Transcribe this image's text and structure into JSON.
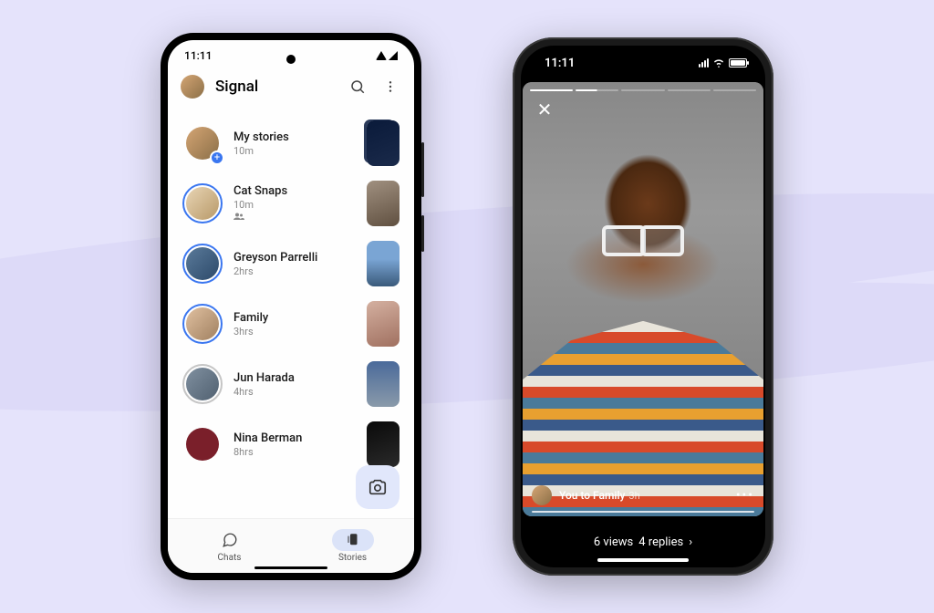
{
  "android": {
    "statusbar": {
      "time": "11:11"
    },
    "header": {
      "title": "Signal"
    },
    "stories": [
      {
        "name": "My stories",
        "time": "10m",
        "mine": true
      },
      {
        "name": "Cat Snaps",
        "time": "10m",
        "group": true
      },
      {
        "name": "Greyson Parrelli",
        "time": "2hrs"
      },
      {
        "name": "Family",
        "time": "3hrs"
      },
      {
        "name": "Jun Harada",
        "time": "4hrs"
      },
      {
        "name": "Nina Berman",
        "time": "8hrs"
      }
    ],
    "nav": {
      "chats": "Chats",
      "stories": "Stories"
    }
  },
  "iphone": {
    "statusbar": {
      "time": "11:11"
    },
    "story": {
      "author": "You to Family",
      "time": "3h",
      "views_label": "6 views",
      "replies_label": "4 replies"
    }
  }
}
